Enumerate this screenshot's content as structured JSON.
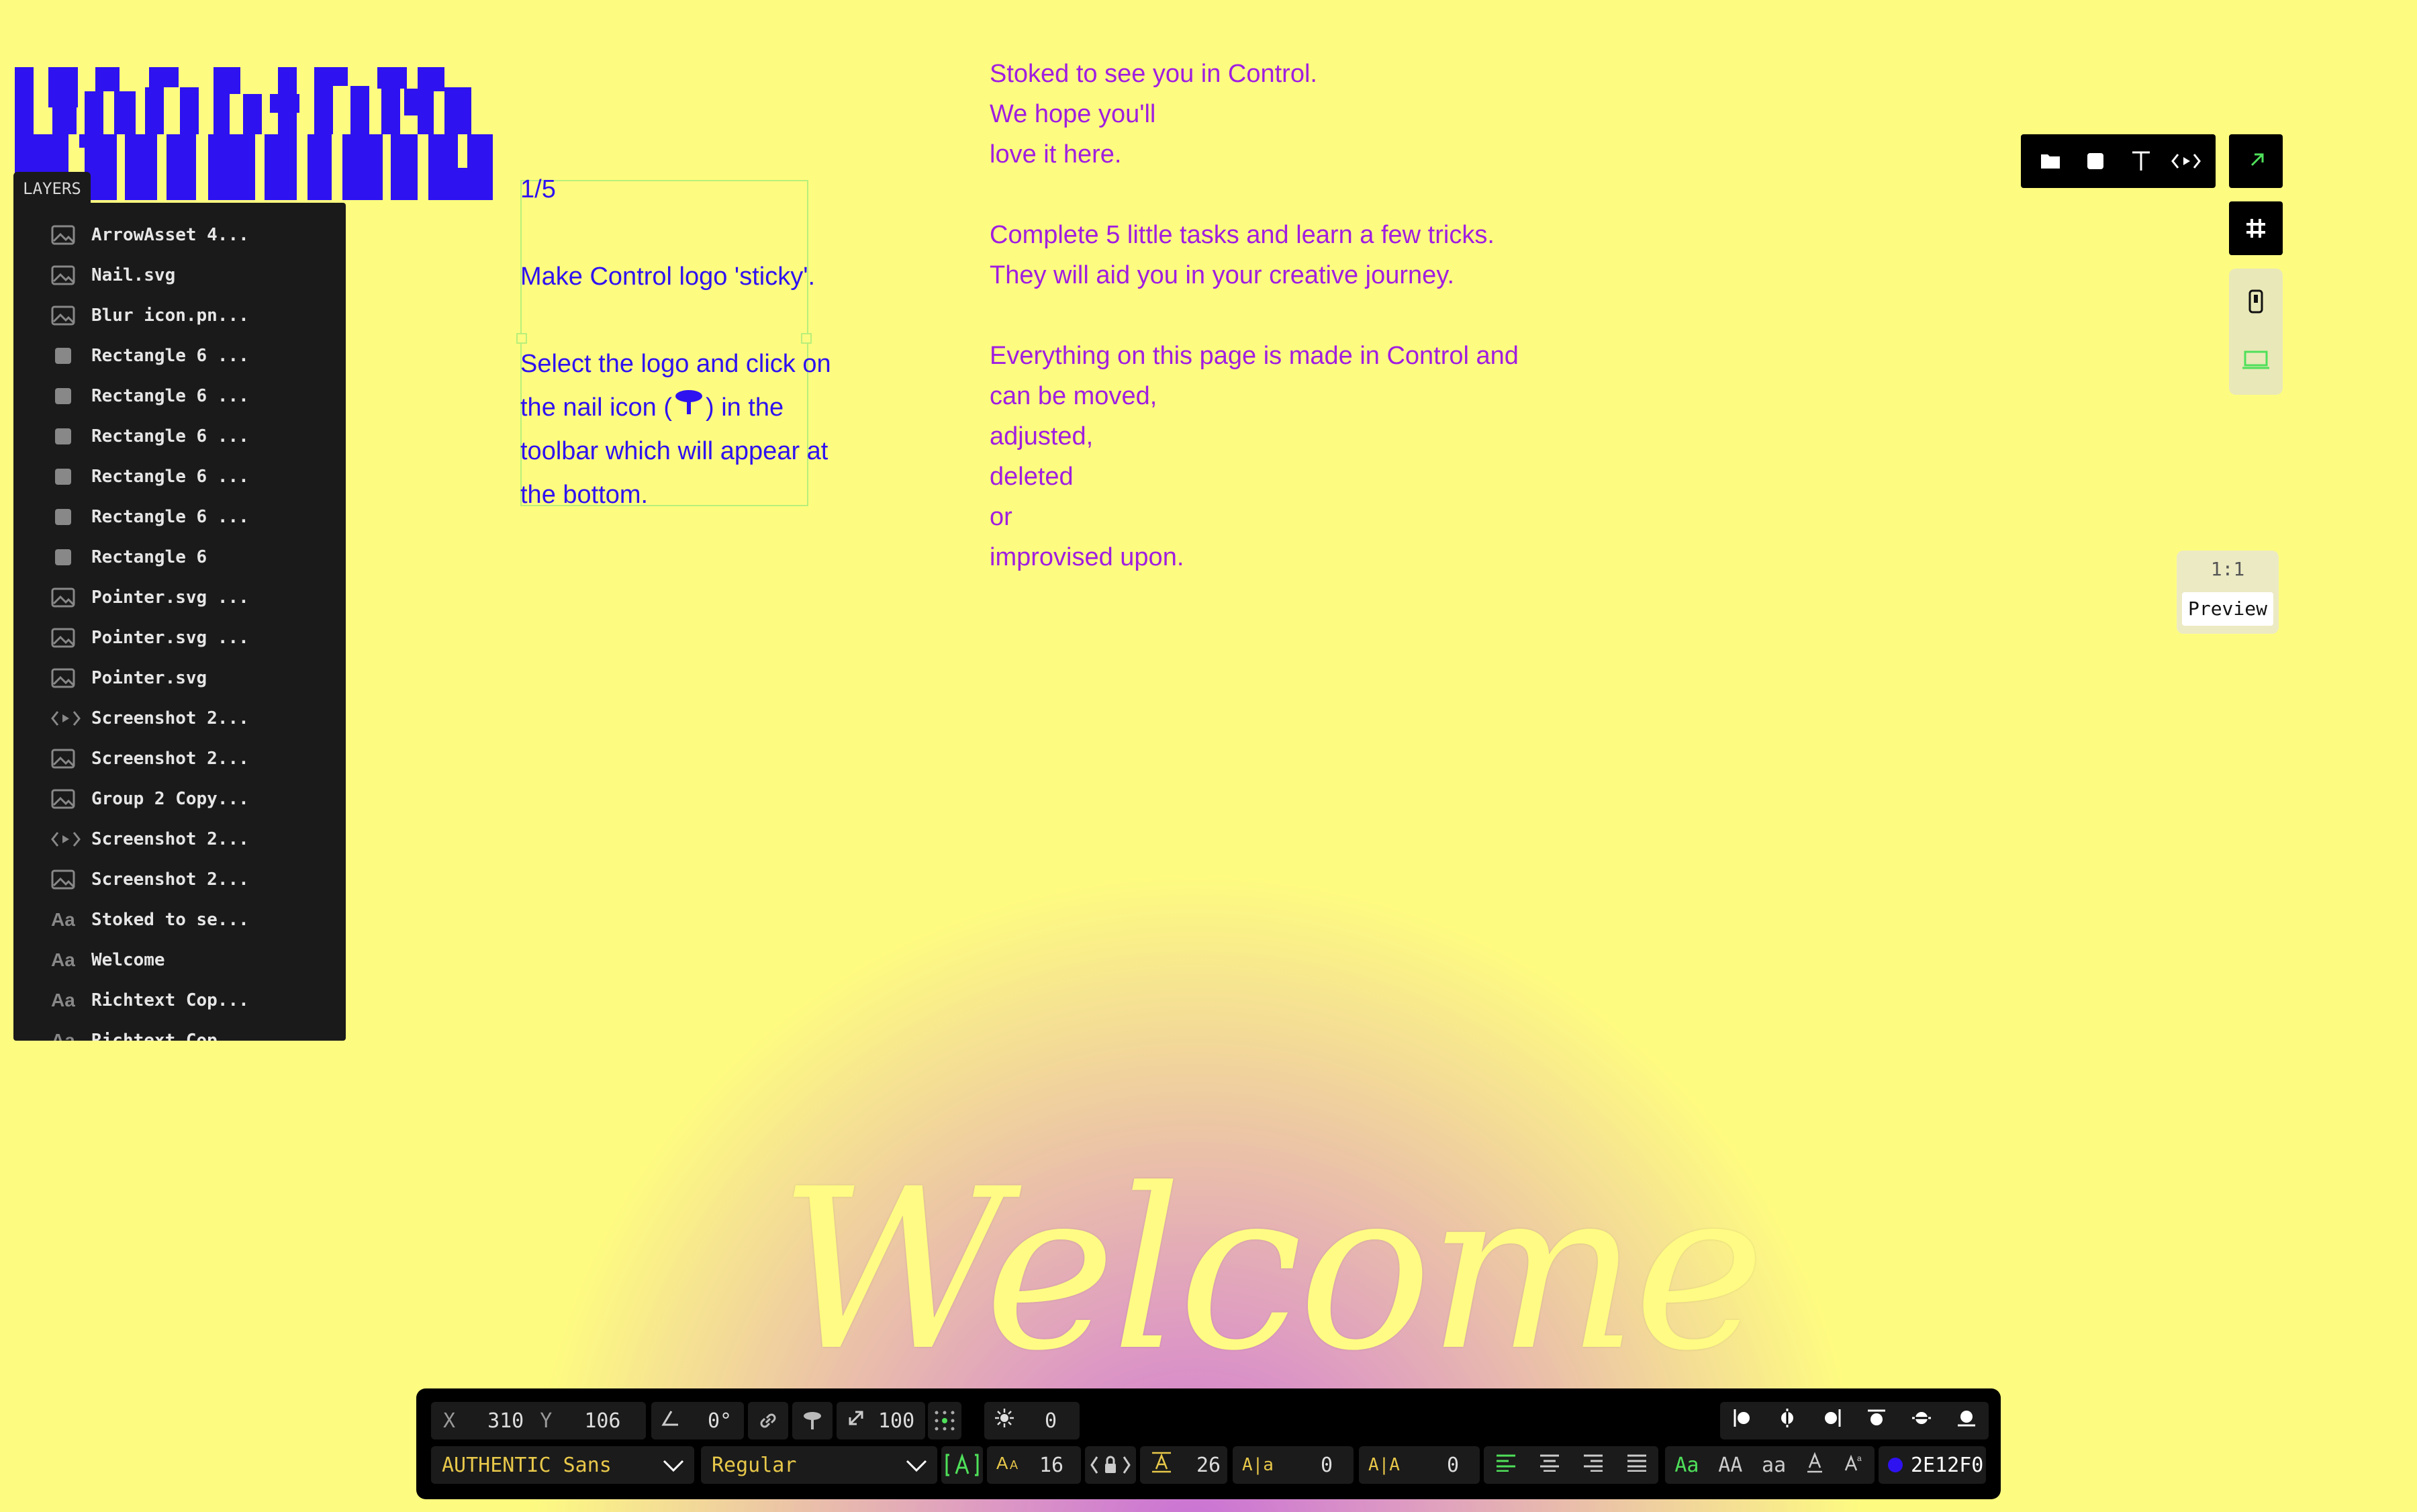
{
  "intro": {
    "lines": [
      "Stoked to see you in Control.",
      "We hope you'll",
      "love it here.",
      "",
      "Complete 5 little tasks and learn a few tricks.",
      "They will aid you in your creative journey.",
      "",
      "Everything on this page is made in Control and",
      "can be moved,",
      "adjusted,",
      "deleted",
      "or",
      "improvised upon."
    ],
    "color": "#a01ee0"
  },
  "task": {
    "counter": "1/5",
    "title": "Make Control logo 'sticky'.",
    "instructions": [
      "Select the logo and click on",
      "the nail icon (",
      ") in the",
      "toolbar which will appear at",
      "the bottom."
    ],
    "color": "#2e12f0"
  },
  "welcome_text": "Welcome",
  "layers": {
    "tab_label": "LAYERS",
    "items": [
      {
        "icon": "image-icon",
        "label": "ArrowAsset 4..."
      },
      {
        "icon": "image-icon",
        "label": "Nail.svg"
      },
      {
        "icon": "image-icon",
        "label": "Blur icon.pn..."
      },
      {
        "icon": "rectangle-icon",
        "label": "Rectangle 6 ..."
      },
      {
        "icon": "rectangle-icon",
        "label": "Rectangle 6 ..."
      },
      {
        "icon": "rectangle-icon",
        "label": "Rectangle 6 ..."
      },
      {
        "icon": "rectangle-icon",
        "label": "Rectangle 6 ..."
      },
      {
        "icon": "rectangle-icon",
        "label": "Rectangle 6 ..."
      },
      {
        "icon": "rectangle-icon",
        "label": "Rectangle 6"
      },
      {
        "icon": "image-icon",
        "label": "Pointer.svg ..."
      },
      {
        "icon": "image-icon",
        "label": "Pointer.svg ..."
      },
      {
        "icon": "image-icon",
        "label": "Pointer.svg"
      },
      {
        "icon": "embed-icon",
        "label": "Screenshot 2..."
      },
      {
        "icon": "image-icon",
        "label": "Screenshot 2..."
      },
      {
        "icon": "image-icon",
        "label": "Group 2 Copy..."
      },
      {
        "icon": "embed-icon",
        "label": "Screenshot 2..."
      },
      {
        "icon": "image-icon",
        "label": "Screenshot 2..."
      },
      {
        "icon": "text-icon",
        "label": "Stoked to se..."
      },
      {
        "icon": "text-icon",
        "label": "Welcome"
      },
      {
        "icon": "text-icon",
        "label": "Richtext Cop..."
      },
      {
        "icon": "text-icon",
        "label": "Richtext Cop..."
      }
    ]
  },
  "right_panel": {
    "ratio_label": "1:1",
    "preview_label": "Preview"
  },
  "toolbar": {
    "x_label": "X",
    "x_value": "310",
    "y_label": "Y",
    "y_value": "106",
    "rotation_value": "0°",
    "scale_value": "100",
    "blur_value": "0",
    "font_family": "AUTHENTIC Sans",
    "font_weight": "Regular",
    "font_size": "16",
    "line_height": "26",
    "letter_spacing": "0",
    "word_spacing": "0",
    "case_options": [
      "Aa",
      "AA",
      "aa"
    ],
    "color_hex": "2E12F0",
    "color": "#2e12f0"
  },
  "colors": {
    "background": "#fefc80",
    "logo": "#2e12f0",
    "accent_green": "#4fe05a"
  }
}
